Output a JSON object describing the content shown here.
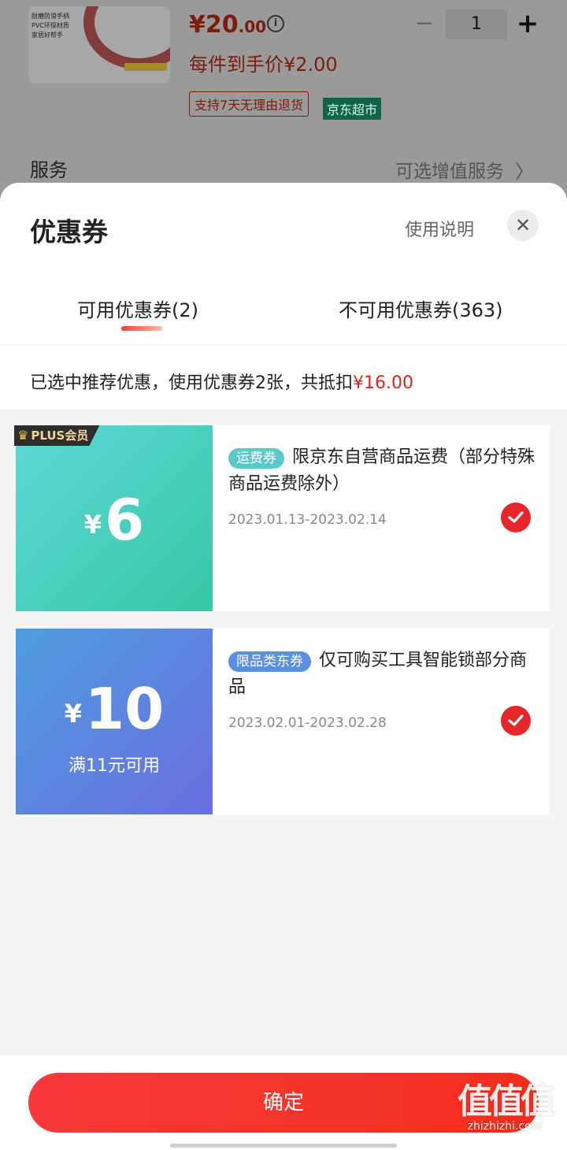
{
  "product": {
    "features": [
      "耐磨防滑手柄",
      "PVC环保材质",
      "家居好帮手"
    ],
    "price_main": "¥20",
    "price_decimal": ".00",
    "quantity": "1",
    "minus_label": "−",
    "plus_label": "+",
    "each_price": "每件到手价¥2.00",
    "return_policy": "支持7天无理由退货",
    "store_tag": "京东超市",
    "service_label": "服务",
    "service_value": "可选增值服务",
    "chevron": "〉"
  },
  "sheet": {
    "title": "优惠券",
    "help_link": "使用说明",
    "close_glyph": "✕",
    "tabs": [
      {
        "label": "可用优惠券(2)",
        "active": true
      },
      {
        "label": "不可用优惠券(363)",
        "active": false
      }
    ],
    "summary_text": "已选中推荐优惠，使用优惠券2张，共抵扣",
    "summary_amount": "¥16.00"
  },
  "coupons": [
    {
      "badge": "PLUS会员",
      "currency": "¥",
      "amount": "6",
      "condition": "",
      "type_label": "运费券",
      "description": "限京东自营商品运费（部分特殊商品运费除外）",
      "date_range": "2023.01.13-2023.02.14",
      "selected": true
    },
    {
      "badge": "",
      "currency": "¥",
      "amount": "10",
      "condition": "满11元可用",
      "type_label": "限品类东券",
      "description": "仅可购买工具智能锁部分商品",
      "date_range": "2023.02.01-2023.02.28",
      "selected": true
    }
  ],
  "footer": {
    "confirm_label": "确定"
  },
  "watermark": {
    "logo": "值值值",
    "url": "zhizhizhi.com"
  },
  "colors": {
    "accent_red": "#e2231a",
    "coupon1_gradient": [
      "#5fd8d8",
      "#36c7a6"
    ],
    "coupon2_gradient": [
      "#4f9de0",
      "#6a6ee0"
    ],
    "jd_green": "#12634a"
  }
}
